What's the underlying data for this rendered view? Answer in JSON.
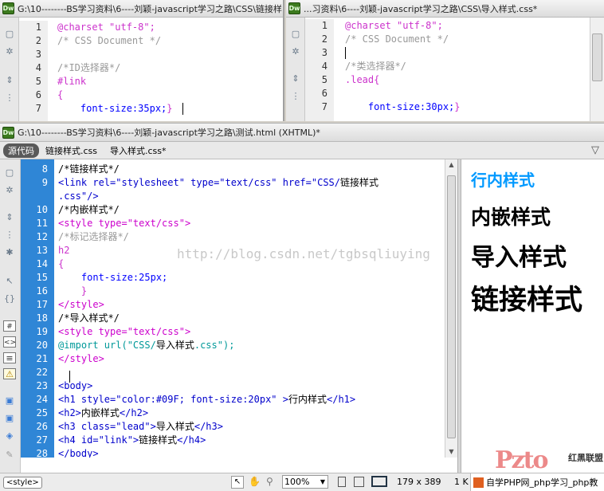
{
  "panes": {
    "link_css": {
      "title": "G:\\10--------BS学习资料\\6----刘颖-javascript学习之路\\CSS\\链接样",
      "app_badge": "Dw",
      "line_numbers": [
        "1",
        "2",
        "3",
        "4",
        "5",
        "6",
        "7"
      ],
      "lines": [
        [
          {
            "t": "@charset \"utf-8\";",
            "c": "#cc33cc"
          }
        ],
        [
          {
            "t": "/* CSS Document */",
            "c": "#999999"
          }
        ],
        [],
        [
          {
            "t": "/*ID选择器*/",
            "c": "#999999"
          }
        ],
        [
          {
            "t": "#link",
            "c": "#cc33cc"
          }
        ],
        [
          {
            "t": "{",
            "c": "#cc33cc"
          }
        ],
        [
          {
            "t": "    font-size:35px;",
            "c": "#0000ff"
          },
          {
            "t": "}",
            "c": "#cc33cc"
          }
        ]
      ]
    },
    "import_css": {
      "title": "...习资料\\6----刘颖-javascript学习之路\\CSS\\导入样式.css*",
      "app_badge": "Dw",
      "line_numbers": [
        "1",
        "2",
        "3",
        "4",
        "5",
        "6",
        "7"
      ],
      "lines": [
        [
          {
            "t": "@charset \"utf-8\";",
            "c": "#cc33cc"
          }
        ],
        [
          {
            "t": "/* CSS Document */",
            "c": "#999999"
          }
        ],
        [],
        [
          {
            "t": "/*类选择器*/",
            "c": "#999999"
          }
        ],
        [
          {
            "t": ".lead{",
            "c": "#cc33cc"
          }
        ],
        [],
        [
          {
            "t": "    font-size:30px;",
            "c": "#0000ff"
          },
          {
            "t": "}",
            "c": "#cc33cc"
          }
        ]
      ]
    },
    "main": {
      "title": "G:\\10--------BS学习资料\\6----刘颖-javascript学习之路\\测试.html (XHTML)*",
      "app_badge": "Dw",
      "tabs": [
        {
          "label": "源代码",
          "active": true
        },
        {
          "label": "链接样式.css",
          "active": false
        },
        {
          "label": "导入样式.css*",
          "active": false
        }
      ],
      "line_numbers": [
        "8",
        "9",
        "",
        "10",
        "11",
        "12",
        "13",
        "14",
        "15",
        "16",
        "17",
        "18",
        "19",
        "20",
        "21",
        "22",
        "23",
        "24",
        "25",
        "26",
        "27",
        "28"
      ],
      "lines": [
        [
          {
            "t": "/*链接样式*/",
            "c": "#000000"
          }
        ],
        [
          {
            "t": "<link rel=\"stylesheet\" type=\"text/css\" href=\"CSS/",
            "c": "#0000cc"
          },
          {
            "t": "链接样式",
            "c": "#000000"
          }
        ],
        [
          {
            "t": ".css\"/>",
            "c": "#0000cc"
          }
        ],
        [
          {
            "t": "/*内嵌样式*/",
            "c": "#000000"
          }
        ],
        [
          {
            "t": "<style type=\"text/css\">",
            "c": "#cc00cc"
          }
        ],
        [
          {
            "t": "/*标记选择器*/",
            "c": "#999999"
          }
        ],
        [
          {
            "t": "h2",
            "c": "#cc33cc"
          }
        ],
        [
          {
            "t": "{",
            "c": "#cc33cc"
          }
        ],
        [
          {
            "t": "    font-size:25px;",
            "c": "#0000ff"
          }
        ],
        [
          {
            "t": "    }",
            "c": "#cc33cc"
          }
        ],
        [
          {
            "t": "</style>",
            "c": "#cc00cc"
          }
        ],
        [
          {
            "t": "/*导入样式*/",
            "c": "#000000"
          }
        ],
        [
          {
            "t": "<style type=\"text/css\">",
            "c": "#cc00cc"
          }
        ],
        [
          {
            "t": "@import url(\"CSS/",
            "c": "#009999"
          },
          {
            "t": "导入样式",
            "c": "#000000"
          },
          {
            "t": ".css\");",
            "c": "#009999"
          }
        ],
        [
          {
            "t": "</style>",
            "c": "#cc00cc"
          }
        ],
        [],
        [
          {
            "t": "<body>",
            "c": "#0000cc"
          }
        ],
        [
          {
            "t": "<h1 style=\"color:#09F; font-size:20px\" >",
            "c": "#0000cc"
          },
          {
            "t": "行内样式",
            "c": "#000000"
          },
          {
            "t": "</h1>",
            "c": "#0000cc"
          }
        ],
        [
          {
            "t": "<h2>",
            "c": "#0000cc"
          },
          {
            "t": "内嵌样式",
            "c": "#000000"
          },
          {
            "t": "</h2>",
            "c": "#0000cc"
          }
        ],
        [
          {
            "t": "<h3 class=\"lead\">",
            "c": "#0000cc"
          },
          {
            "t": "导入样式",
            "c": "#000000"
          },
          {
            "t": "</h3>",
            "c": "#0000cc"
          }
        ],
        [
          {
            "t": "<h4 id=\"link\">",
            "c": "#0000cc"
          },
          {
            "t": "链接样式",
            "c": "#000000"
          },
          {
            "t": "</h4>",
            "c": "#0000cc"
          }
        ],
        [
          {
            "t": "</body>",
            "c": "#0000cc"
          }
        ]
      ],
      "watermark": "http://blog.csdn.net/tgbsqliuying"
    }
  },
  "preview": {
    "h1": "行内样式",
    "h2": "内嵌样式",
    "h3": "导入样式",
    "h4": "链接样式",
    "h1_color": "#0099ff",
    "logo_text": "红黑联盟",
    "logo_mark": "Pzto"
  },
  "statusbar": {
    "tag": "<style>",
    "zoom": "100%",
    "dimensions": "179 x 389",
    "extra": "1 K",
    "ad_text": "自学PHP网_php学习_php教"
  }
}
